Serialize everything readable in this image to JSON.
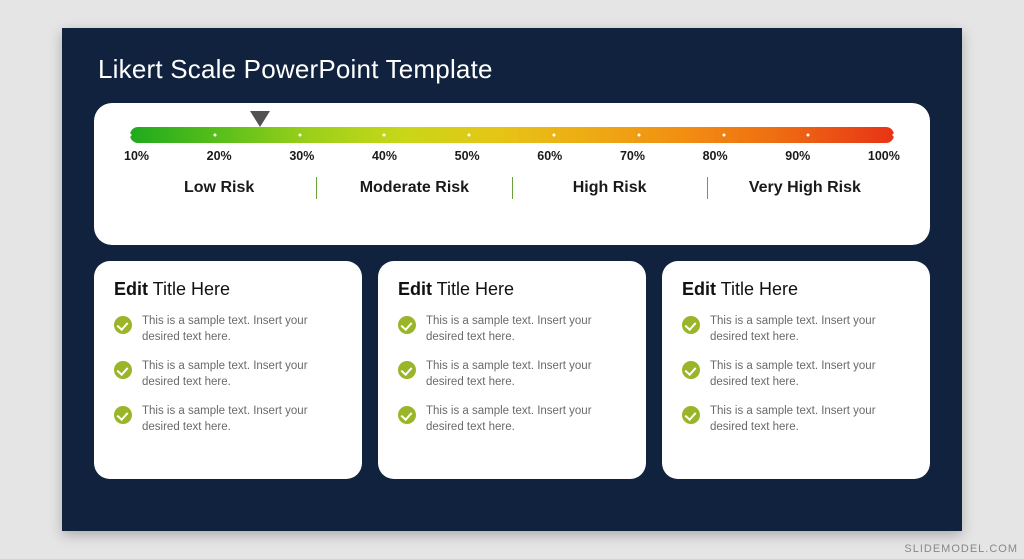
{
  "title": "Likert Scale PowerPoint Template",
  "gauge": {
    "ticks": [
      "10%",
      "20%",
      "30%",
      "40%",
      "50%",
      "60%",
      "70%",
      "80%",
      "90%",
      "100%"
    ],
    "risk_labels": [
      "Low Risk",
      "Moderate Risk",
      "High Risk",
      "Very High Risk"
    ],
    "marker_position_percent": 17
  },
  "cards": [
    {
      "title_bold": "Edit",
      "title_rest": " Title Here",
      "bullets": [
        "This is a sample text. Insert your desired text here.",
        "This is a sample text. Insert your desired text here.",
        "This is a sample text. Insert your desired text here."
      ]
    },
    {
      "title_bold": "Edit",
      "title_rest": " Title Here",
      "bullets": [
        "This is a sample text. Insert your desired text here.",
        "This is a sample text. Insert your desired text here.",
        "This is a sample text. Insert your desired text here."
      ]
    },
    {
      "title_bold": "Edit",
      "title_rest": " Title Here",
      "bullets": [
        "This is a sample text. Insert your desired text here.",
        "This is a sample text. Insert your desired text here.",
        "This is a sample text. Insert your desired text here."
      ]
    }
  ],
  "watermark": "SLIDEMODEL.COM"
}
